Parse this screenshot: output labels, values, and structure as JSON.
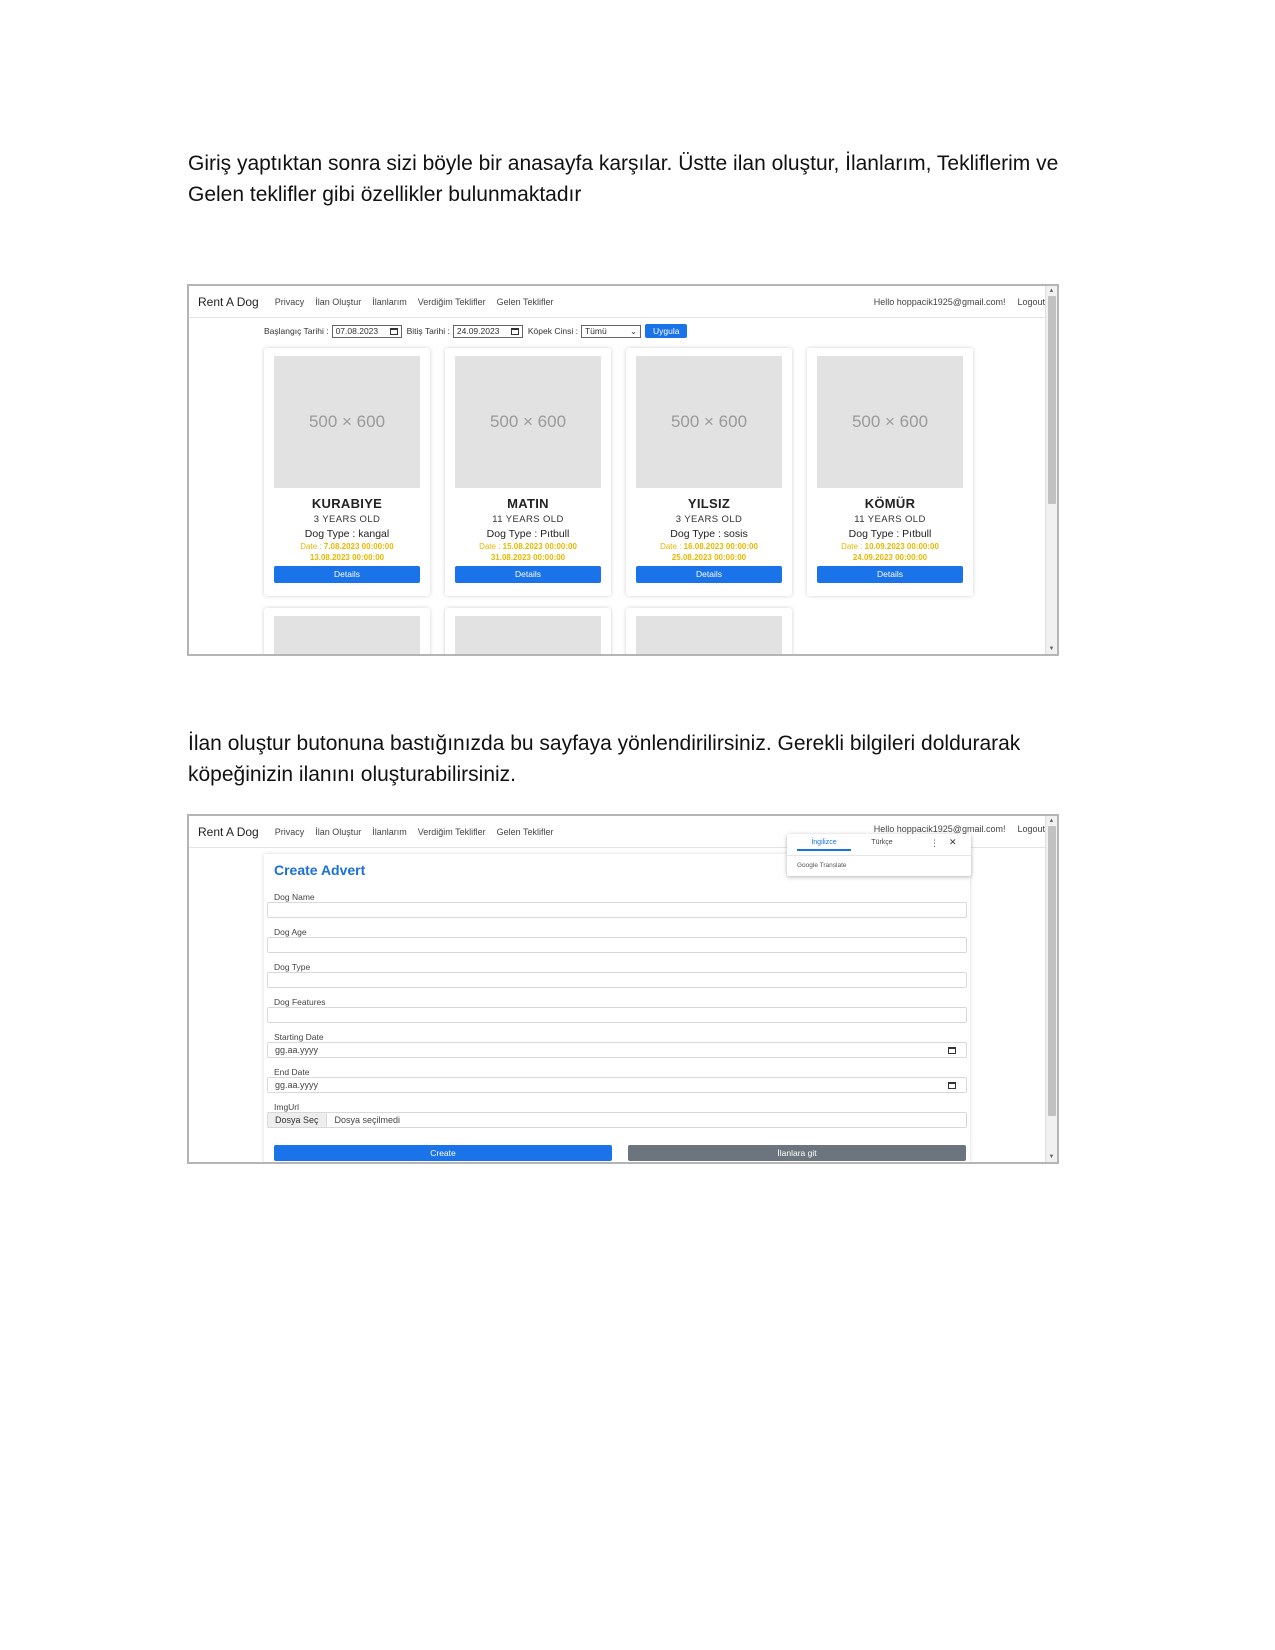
{
  "paragraphs": {
    "p1_line1": "Giriş yaptıktan sonra sizi böyle bir anasayfa karşılar. Üstte ilan oluştur, İlanlarım, Tekliflerim ve",
    "p1_line2": "Gelen teklifler gibi özellikler bulunmaktadır",
    "p2_line1": "İlan oluştur butonuna bastığınızda bu sayfaya yönlendirilirsiniz. Gerekli bilgileri doldurarak",
    "p2_line2": "köpeğinizin ilanını oluşturabilirsiniz."
  },
  "navbar": {
    "brand": "Rent A Dog",
    "links": [
      "Privacy",
      "İlan Oluştur",
      "İlanlarım",
      "Verdiğim Teklifler",
      "Gelen Teklifler"
    ],
    "greeting": "Hello hoppacik1925@gmail.com!",
    "logout": "Logout"
  },
  "filters": {
    "start_label": "Başlangıç Tarihi :",
    "start_value": "07.08.2023",
    "end_label": "Bitiş Tarihi :",
    "end_value": "24.09.2023",
    "type_label": "Köpek Cinsi :",
    "type_value": "Tümü",
    "apply": "Uygula"
  },
  "cards": [
    {
      "placeholder": "500 × 600",
      "name": "KURABIYE",
      "age": "3 YEARS OLD",
      "type": "Dog Type : kangal",
      "date_label": "Date :",
      "date_start": "7.08.2023 00:00:00",
      "date_end": "13.08.2023 00:00:00",
      "button": "Details"
    },
    {
      "placeholder": "500 × 600",
      "name": "MATIN",
      "age": "11 YEARS OLD",
      "type": "Dog Type : Pıtbull",
      "date_label": "Date :",
      "date_start": "15.08.2023 00:00:00",
      "date_end": "31.08.2023 00:00:00",
      "button": "Details"
    },
    {
      "placeholder": "500 × 600",
      "name": "YILSIZ",
      "age": "3 YEARS OLD",
      "type": "Dog Type : sosis",
      "date_label": "Date :",
      "date_start": "16.08.2023 00:00:00",
      "date_end": "25.08.2023 00:00:00",
      "button": "Details"
    },
    {
      "placeholder": "500 × 600",
      "name": "KÖMÜR",
      "age": "11 YEARS OLD",
      "type": "Dog Type : Pıtbull",
      "date_label": "Date :",
      "date_start": "10.09.2023 00:00:00",
      "date_end": "24.09.2023 00:00:00",
      "button": "Details"
    }
  ],
  "form": {
    "title": "Create Advert",
    "dog_name_label": "Dog Name",
    "dog_age_label": "Dog Age",
    "dog_type_label": "Dog Type",
    "dog_features_label": "Dog Features",
    "starting_date_label": "Starting Date",
    "starting_date_placeholder": "gg.aa.yyyy",
    "end_date_label": "End Date",
    "end_date_placeholder": "gg.aa.yyyy",
    "imgurl_label": "ImgUrl",
    "file_button": "Dosya Seç",
    "file_status": "Dosya seçilmedi",
    "create_button": "Create",
    "back_button": "İlanlara git"
  },
  "translate_popup": {
    "tab_english": "İngilizce",
    "tab_turkish": "Türkçe",
    "brand": "Google Translate"
  }
}
